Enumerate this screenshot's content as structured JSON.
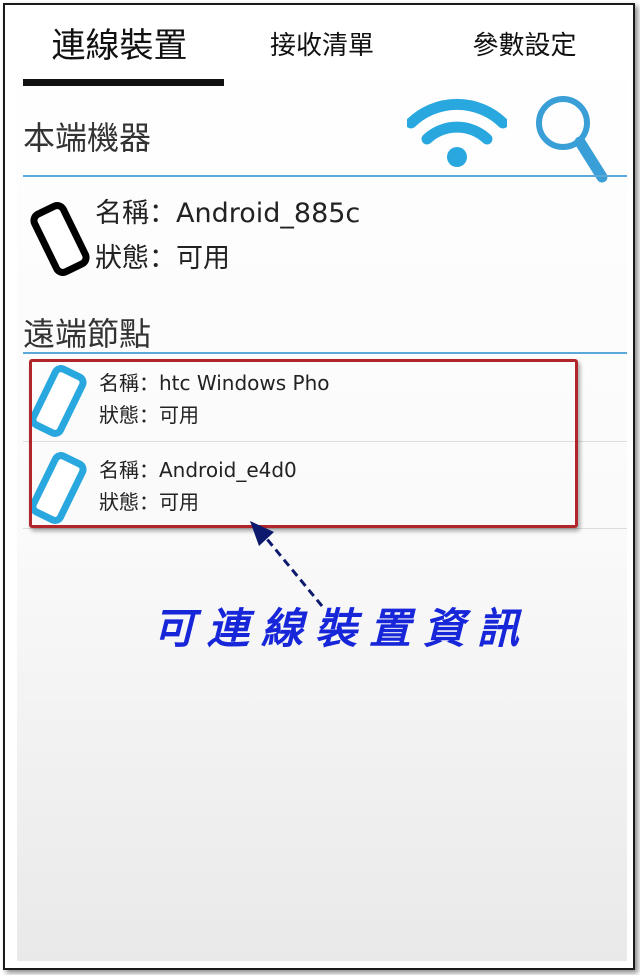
{
  "tabs": [
    {
      "label": "連線裝置",
      "active": true
    },
    {
      "label": "接收清單",
      "active": false
    },
    {
      "label": "參數設定",
      "active": false
    }
  ],
  "local": {
    "title": "本端機器",
    "name_label": "名稱：",
    "name": "Android_885c",
    "status_label": "狀態：",
    "status": "可用",
    "actions": [
      "wifi-icon",
      "search-icon"
    ]
  },
  "remote": {
    "title": "遠端節點",
    "items": [
      {
        "name_label": "名稱：",
        "name": "htc Windows Pho",
        "status_label": "狀態：",
        "status": "可用"
      },
      {
        "name_label": "名稱：",
        "name": "Android_e4d0",
        "status_label": "狀態：",
        "status": "可用"
      }
    ]
  },
  "annotation": {
    "text": "可連線裝置資訊"
  },
  "colors": {
    "accent": "#5aa9d8",
    "phone_blue": "#29a8e0",
    "highlight": "#b0262a",
    "annotation": "#1626d8"
  }
}
